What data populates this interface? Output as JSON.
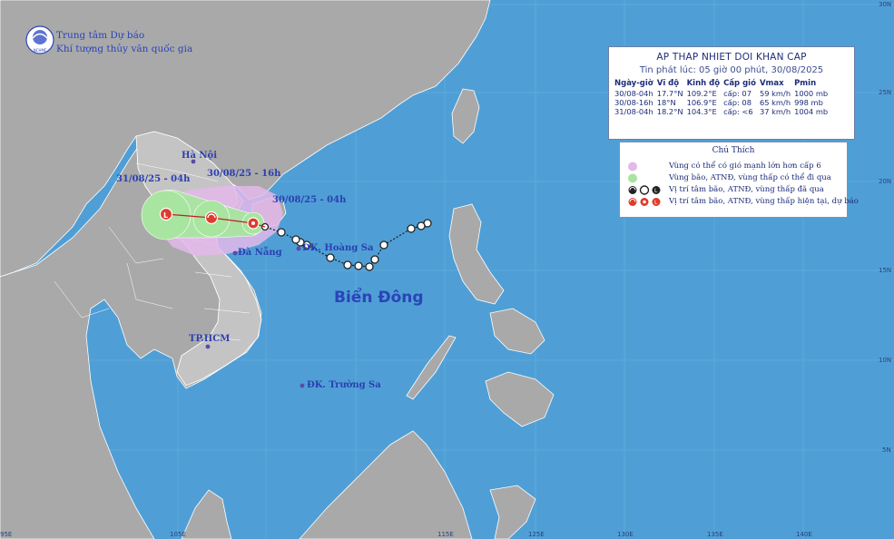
{
  "agency": {
    "line1": "Trung tâm Dự báo",
    "line2": "Khí tượng thủy văn quốc gia",
    "logo_text": "NCHMF"
  },
  "bulletin": {
    "title": "AP THAP NHIET DOI KHAN CAP",
    "issued": "Tin phát lúc: 05 giờ 00 phút, 30/08/2025",
    "headers": [
      "Ngày-giờ",
      "Vĩ độ",
      "Kinh độ",
      "Cấp gió",
      "Vmax",
      "Pmin"
    ],
    "rows": [
      [
        "30/08-04h",
        "17.7°N",
        "109.2°E",
        "cấp: 07",
        "59 km/h",
        "1000 mb"
      ],
      [
        "30/08-16h",
        "18°N",
        "106.9°E",
        "cấp: 08",
        "65 km/h",
        "998 mb"
      ],
      [
        "31/08-04h",
        "18.2°N",
        "104.3°E",
        "cấp: <6",
        "37 km/h",
        "1004 mb"
      ]
    ]
  },
  "legend": {
    "title": "Chú Thích",
    "items": [
      {
        "text": "Vùng có thể có gió mạnh lớn hơn cấp 6",
        "color": "#e3b8ea"
      },
      {
        "text": "Vùng bão, ATNĐ, vùng thấp có thể đi qua",
        "color": "#a8e5a0"
      },
      {
        "text": "Vị trí tâm bão, ATNĐ, vùng thấp đã qua",
        "color": "#222222"
      },
      {
        "text": "Vị trí tâm bão, ATNĐ, vùng thấp hiện tại, dự báo",
        "color": "#e13a2a"
      }
    ]
  },
  "labels": {
    "ha_noi": "Hà Nội",
    "da_nang": "Đà Nẵng",
    "tp_hcm": "TP.HCM",
    "hoang_sa": "ĐK. Hoàng Sa",
    "truong_sa": "ĐK. Trường Sa",
    "sea": "Biển Đông",
    "fc1": "30/08/25 - 04h",
    "fc2": "30/08/25 - 16h",
    "fc3": "31/08/25 - 04h"
  },
  "axes": {
    "lon_ticks": [
      "95E",
      "105E",
      "115E",
      "125E",
      "130E",
      "135E",
      "140E"
    ],
    "lat_ticks": [
      "30N",
      "25N",
      "20N",
      "15N",
      "10N",
      "5N"
    ]
  },
  "track": {
    "past_points": [
      [
        471,
        246
      ],
      [
        464,
        249
      ],
      [
        453,
        252
      ],
      [
        423,
        270
      ],
      [
        413,
        286
      ],
      [
        407,
        294
      ],
      [
        395,
        293
      ],
      [
        383,
        292
      ],
      [
        364,
        284
      ],
      [
        338,
        270
      ],
      [
        331,
        267
      ],
      [
        326,
        264
      ],
      [
        310,
        256
      ],
      [
        292,
        250
      ]
    ],
    "current": {
      "lat": 17.7,
      "lon": 109.2
    },
    "forecast": [
      {
        "lat": 18.0,
        "lon": 106.9
      },
      {
        "lat": 18.2,
        "lon": 104.3
      }
    ]
  }
}
